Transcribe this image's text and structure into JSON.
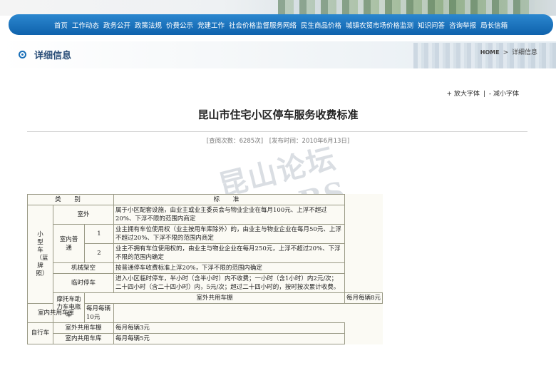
{
  "nav": {
    "items": [
      "首页",
      "工作动态",
      "政务公开",
      "政策法规",
      "价费公示",
      "党建工作",
      "社会价格监督服务网络",
      "民生商品价格",
      "城镇农贸市场价格监测",
      "知识问答",
      "咨询举报",
      "局长信箱"
    ]
  },
  "section": {
    "title": "详细信息",
    "breadcrumb_home": "HOME",
    "breadcrumb_sep": ">",
    "breadcrumb_current": "详细信息"
  },
  "font_ctrl": {
    "enlarge": "+ 放大字体",
    "divider": "|",
    "shrink": "- 减小字体"
  },
  "article": {
    "title": "昆山市住宅小区停车服务收费标准",
    "views": "[查阅次数：6285次]",
    "published": "[发布时间：2010年6月13日]"
  },
  "table": {
    "header": [
      "类 别",
      "标 准"
    ],
    "small_car_label": "小型车（蓝牌照）",
    "rows": {
      "outdoor_label": "室外",
      "outdoor_std": "属于小区配套设施，由业主或业主委员会与物业企业在每月100元、上浮不超过20%、下浮不限的范围内商定",
      "indoor_label": "室内普通",
      "indoor_1_no": "1",
      "indoor_1_std": "业主拥有车位使用权（业主按用车库除外）的，由业主与物业企业在每月50元、上浮不超过20%、下浮不限的范围内商定",
      "indoor_2_no": "2",
      "indoor_2_std": "业主不拥有车位使用权的，由业主与物业企业在每月250元，上浮不超过20%、下浮不限的范围内确定",
      "mech_label": "机械架空",
      "mech_std": "按普通停车收费标准上浮20%，下浮不限的范围内确定",
      "temp_label": "临时停车",
      "temp_std": "进入小区临时停车，半小时（含半小时）内不收费；一小时（含1小时）内2元/次；二十四小时（含二十四小时）内，5元/次；超过二十四小时的，按时按次累计收费。",
      "moto_label": "摩托车助力车电瓶车",
      "moto_out_label": "室外共用车棚",
      "moto_out_std": "每月每辆8元",
      "moto_in_label": "室内共用车库",
      "moto_in_std": "每月每辆10元",
      "bike_label": "自行车",
      "bike_out_label": "室外共用车棚",
      "bike_out_std": "每月每辆3元",
      "bike_in_label": "室内共用车库",
      "bike_in_std": "每月每辆5元"
    }
  },
  "watermark": "昆山论坛 KSBBS",
  "colors": {
    "nav": "#1a70bb",
    "section_title": "#2a4e78",
    "table_border": "#9a9a86"
  }
}
